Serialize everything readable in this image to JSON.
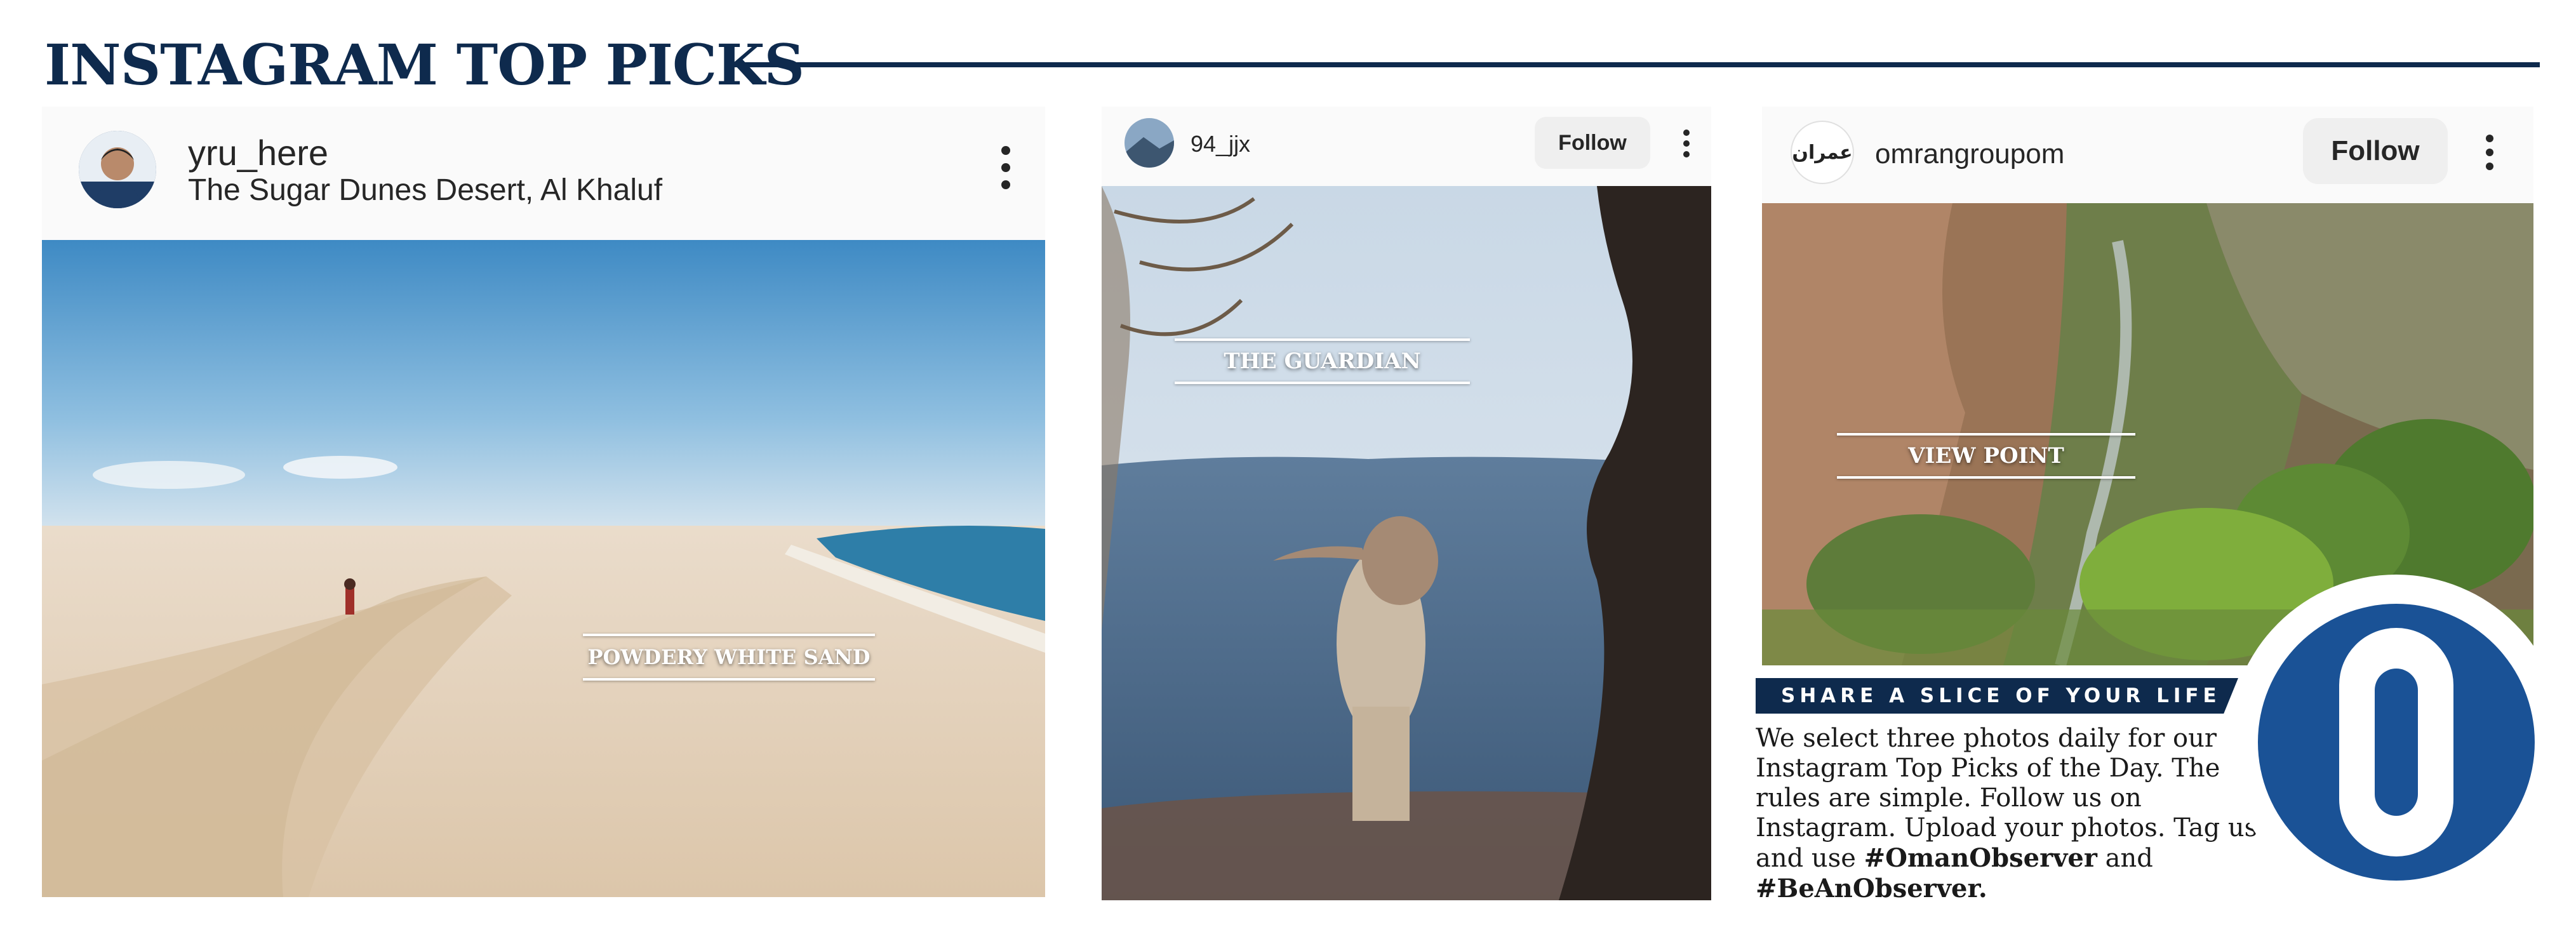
{
  "header": {
    "title": "INSTAGRAM TOP PICKS"
  },
  "posts": [
    {
      "username": "yru_here",
      "location": "The Sugar Dunes Desert, Al Khaluf",
      "caption": "POWDERY WHITE SAND",
      "menu_icon": "more-vertical-icon",
      "avatar_icon": "user-avatar"
    },
    {
      "username": "94_jjx",
      "follow_label": "Follow",
      "caption": "THE GUARDIAN",
      "menu_icon": "more-vertical-icon",
      "avatar_icon": "user-avatar"
    },
    {
      "username": "omrangroupom",
      "follow_label": "Follow",
      "caption": "VIEW POINT",
      "menu_icon": "more-vertical-icon",
      "avatar_icon": "brand-logo-avatar",
      "avatar_logo_text": "عمران"
    }
  ],
  "info": {
    "banner": "SHARE A SLICE OF YOUR LIFE",
    "text_before": "We select three photos daily for our Instagram Top Picks of the Day. The rules are simple. Follow us on Instagram. Upload your photos. Tag us and use ",
    "hashtag1": "#OmanObserver",
    "text_and": " and ",
    "hashtag2": "#BeAnObserver."
  },
  "brand": {
    "badge_icon": "oman-observer-logo",
    "accent": "#0e2a4d",
    "badge_blue": "#1a5296"
  }
}
